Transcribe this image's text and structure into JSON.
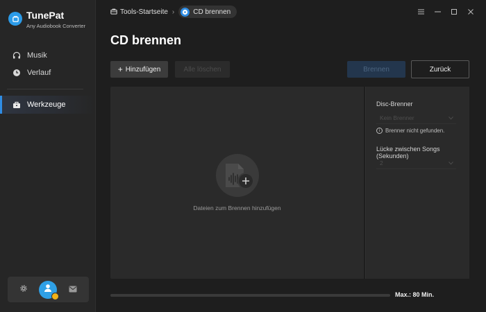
{
  "app": {
    "name": "TunePat",
    "subtitle": "Any Audiobook Converter"
  },
  "sidebar": {
    "items": [
      {
        "label": "Musik",
        "icon": "headphones-icon"
      },
      {
        "label": "Verlauf",
        "icon": "clock-icon"
      },
      {
        "label": "Werkzeuge",
        "icon": "toolbox-icon",
        "active": true
      }
    ],
    "bottom": {
      "settings_icon": "gear-icon",
      "avatar_icon": "user-avatar-icon",
      "mail_icon": "mail-icon"
    }
  },
  "breadcrumb": {
    "home": "Tools-Startseite",
    "current": "CD brennen"
  },
  "window_controls": [
    "menu-icon",
    "minimize-icon",
    "maximize-icon",
    "close-icon"
  ],
  "page": {
    "title": "CD brennen"
  },
  "toolbar": {
    "add_label": "Hinzufügen",
    "delete_label": "Alle löschen",
    "burn_label": "Brennen",
    "back_label": "Zurück"
  },
  "dropzone": {
    "text": "Dateien zum Brennen hinzufügen"
  },
  "settings": {
    "burner_label": "Disc-Brenner",
    "burner_value": "Kein Brenner",
    "burner_note": "Brenner nicht gefunden.",
    "gap_label": "Lücke zwischen Songs (Sekunden)",
    "gap_value": "2"
  },
  "capacity": {
    "label": "Max.: 80 Min.",
    "used_fraction": 0
  },
  "colors": {
    "accent": "#2f8de4",
    "background": "#1e1e1e",
    "sidebar": "#262626",
    "panel": "#2a2a2a"
  }
}
